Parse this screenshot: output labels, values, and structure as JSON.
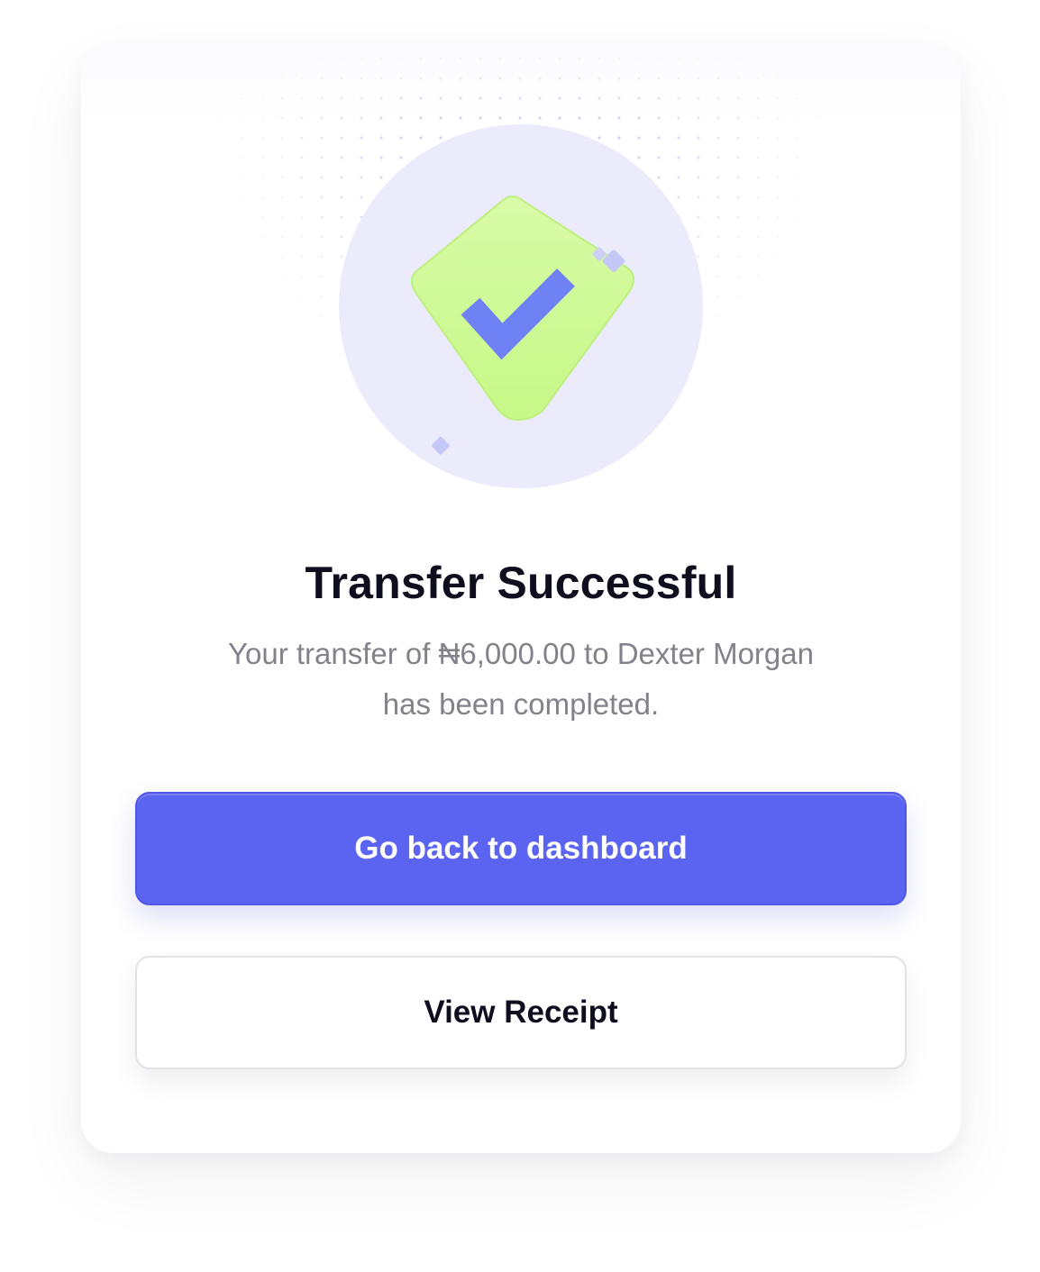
{
  "dialog": {
    "title": "Transfer Successful",
    "message": "Your transfer of ₦6,000.00 to Dexter Morgan has been completed."
  },
  "buttons": {
    "primary_label": "Go back to dashboard",
    "secondary_label": "View Receipt"
  },
  "illustration": {
    "icon": "shield-check-icon",
    "colors": {
      "circle": "#ebebfb",
      "shield": "#c9f98f",
      "check": "#6f82f5",
      "sparkle": "#c3c7f5"
    }
  },
  "colors": {
    "accent": "#5b63f1",
    "title": "#0e0e1f",
    "message": "#82828a"
  }
}
